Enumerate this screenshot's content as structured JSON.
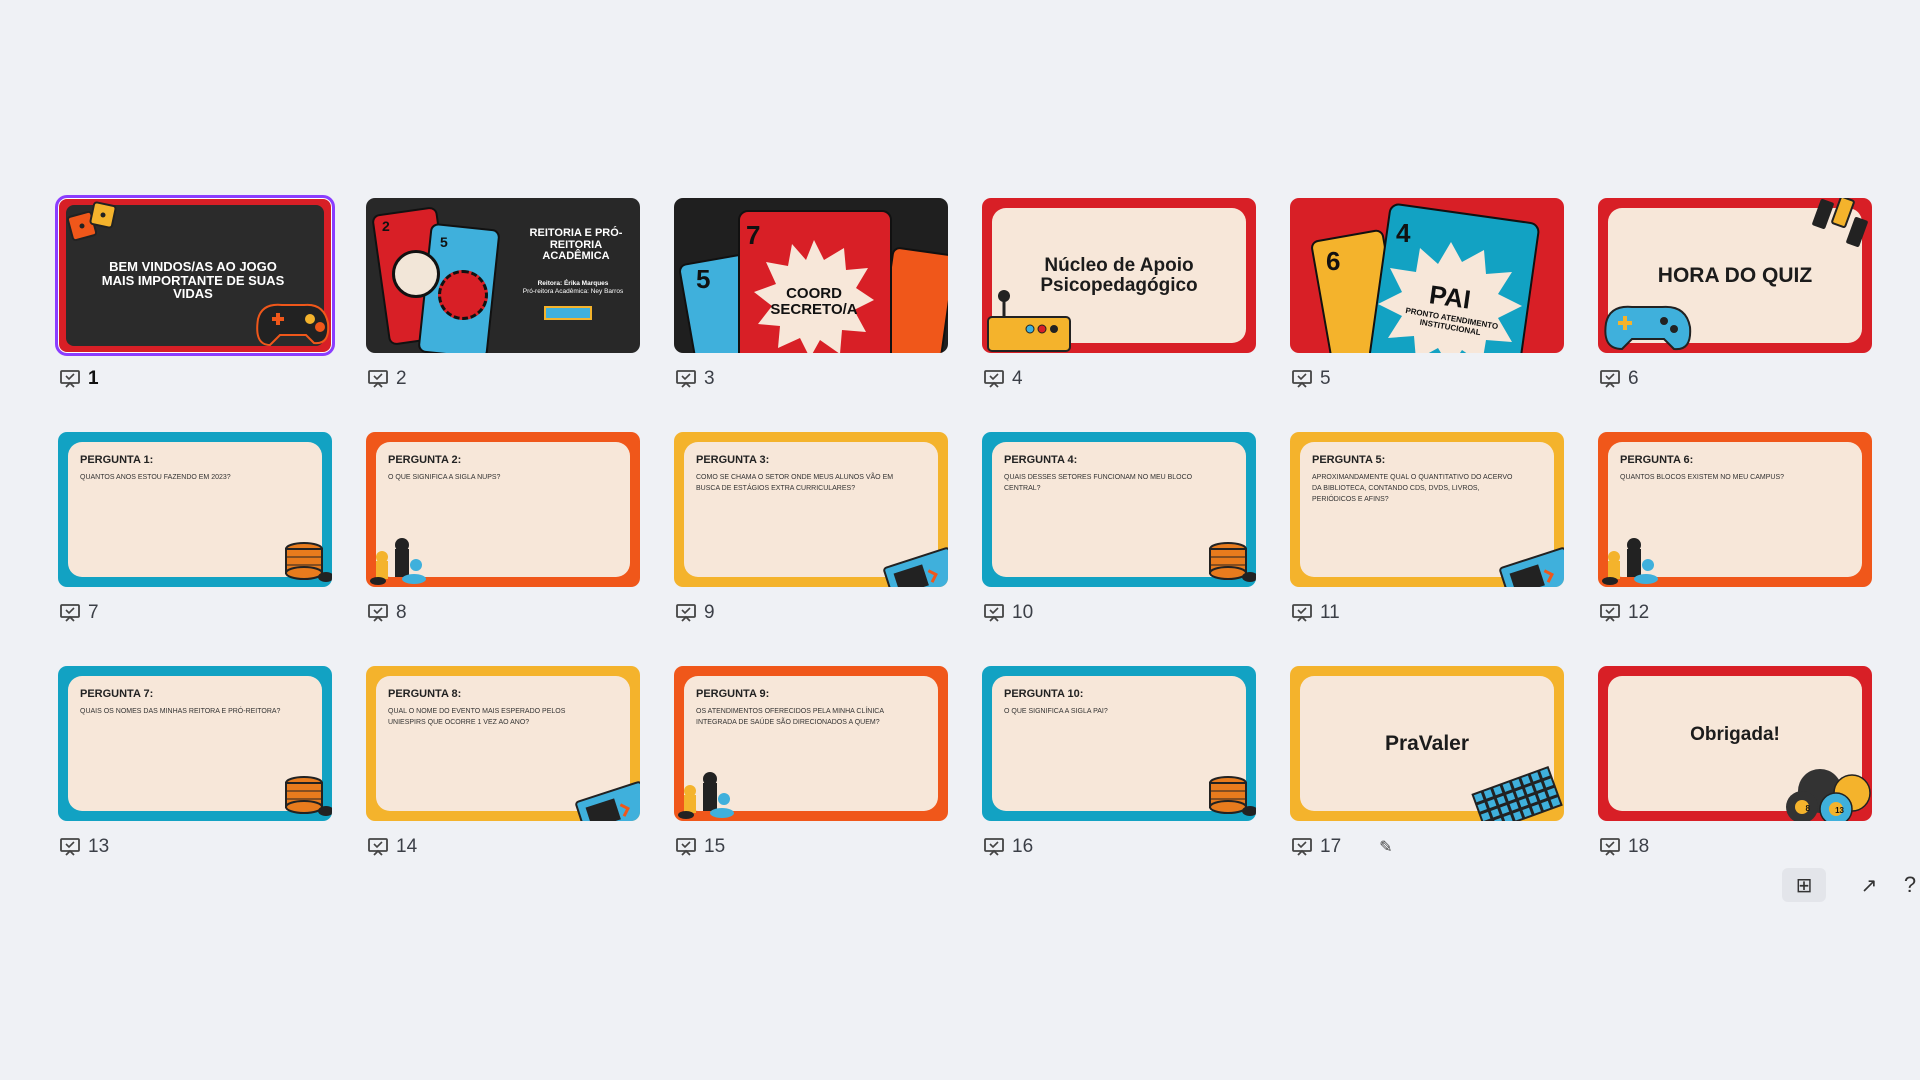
{
  "slides": [
    {
      "number": "1",
      "title": "BEM VINDOS/AS AO JOGO MAIS IMPORTANTE DE SUAS VIDAS"
    },
    {
      "number": "2",
      "title": "REITORIA E PRÓ-REITORIA ACADÊMICA",
      "line1": "Reitora: Érika Marques",
      "line2": "Pró-reitora Acadêmica: Ney Barros",
      "card_a": "2",
      "card_b": "5"
    },
    {
      "number": "3",
      "title_line1": "COORD",
      "title_line2": "SECRETO/A",
      "card_a": "5",
      "card_b": "7"
    },
    {
      "number": "4",
      "title": "Núcleo de Apoio Psicopedagógico"
    },
    {
      "number": "5",
      "title": "PAI",
      "subtitle": "PRONTO ATENDIMENTO INSTITUCIONAL",
      "card_a": "6",
      "card_b": "4"
    },
    {
      "number": "6",
      "title": "HORA DO QUIZ"
    },
    {
      "number": "7",
      "title": "PERGUNTA 1:",
      "text": "QUANTOS ANOS ESTOU FAZENDO EM 2023?"
    },
    {
      "number": "8",
      "title": "PERGUNTA 2:",
      "text": "O QUE SIGNIFICA A SIGLA NUPS?"
    },
    {
      "number": "9",
      "title": "PERGUNTA 3:",
      "text": "COMO SE CHAMA O SETOR ONDE MEUS ALUNOS VÃO EM BUSCA DE ESTÁGIOS EXTRA CURRICULARES?"
    },
    {
      "number": "10",
      "title": "PERGUNTA 4:",
      "text": "QUAIS DESSES SETORES FUNCIONAM NO MEU BLOCO CENTRAL?"
    },
    {
      "number": "11",
      "title": "PERGUNTA 5:",
      "text": "APROXIMANDAMENTE QUAL O QUANTITATIVO DO ACERVO DA BIBLIOTECA, CONTANDO CDS, DVDs, LIVROS, PERIÓDICOS E AFINS?"
    },
    {
      "number": "12",
      "title": "PERGUNTA 6:",
      "text": "QUANTOS BLOCOS EXISTEM NO MEU CAMPUS?"
    },
    {
      "number": "13",
      "title": "PERGUNTA 7:",
      "text": "QUAIS OS NOMES DAS MINHAS REITORA E PRÓ-REITORA?"
    },
    {
      "number": "14",
      "title": "PERGUNTA 8:",
      "text": "QUAL O NOME DO EVENTO MAIS ESPERADO PELOS UNIESPIRS QUE OCORRE 1 VEZ AO ANO?"
    },
    {
      "number": "15",
      "title": "PERGUNTA 9:",
      "text": "OS ATENDIMENTOS OFERECIDOS PELA MINHA CLÍNICA INTEGRADA DE SAÚDE SÃO DIRECIONADOS A QUEM?"
    },
    {
      "number": "16",
      "title": "PERGUNTA 10:",
      "text": "O QUE SIGNIFICA A SIGLA PAI?"
    },
    {
      "number": "17",
      "title": "PraValer"
    },
    {
      "number": "18",
      "title": "Obrigada!",
      "ball_a": "8",
      "ball_b": "13"
    }
  ],
  "controls": {
    "grid_icon": "⊞",
    "expand_icon": "↗",
    "help_icon": "?"
  },
  "colors": {
    "teal": "#12a2c3",
    "orange": "#f0571a",
    "yellow": "#f4b32c",
    "red": "#d81f26",
    "cream": "#f7e7d9",
    "selected": "#8b3dff"
  }
}
